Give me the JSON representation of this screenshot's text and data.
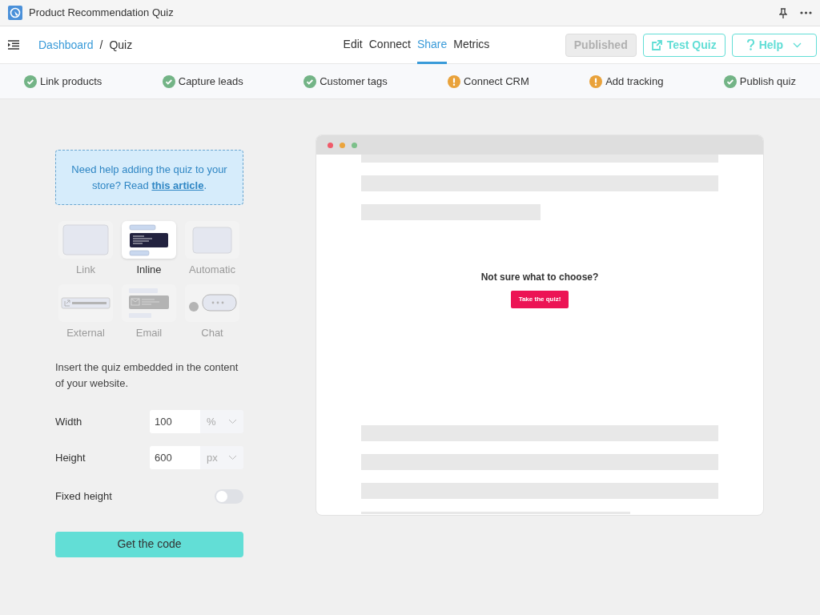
{
  "window": {
    "title": "Product Recommendation Quiz"
  },
  "breadcrumbs": [
    {
      "label": "Dashboard",
      "kind": "link"
    },
    {
      "label": "/",
      "kind": "separator"
    },
    {
      "label": "Quiz",
      "kind": "current"
    }
  ],
  "tabs": [
    {
      "label": "Edit",
      "selected": false
    },
    {
      "label": "Connect",
      "selected": false
    },
    {
      "label": "Share",
      "selected": true
    },
    {
      "label": "Metrics",
      "selected": false
    }
  ],
  "actions": [
    {
      "label": "Published",
      "kind": "status",
      "disabled": true
    },
    {
      "label": "Test Quiz",
      "kind": "external",
      "disabled": false
    },
    {
      "label": "Help",
      "kind": "help",
      "disabled": false
    }
  ],
  "steps": [
    {
      "label": "Link products",
      "done": true
    },
    {
      "label": "Capture leads",
      "done": true
    },
    {
      "label": "Customer tags",
      "done": true
    },
    {
      "label": "Connect CRM",
      "done": false
    },
    {
      "label": "Add tracking",
      "done": false
    },
    {
      "label": "Publish quiz",
      "done": true
    }
  ],
  "help_box": {
    "text_before": "Need help adding the quiz to your store? Read ",
    "link": "this article",
    "text_after": "."
  },
  "embed_types": [
    {
      "label": "Link",
      "kind": "link",
      "selected": false
    },
    {
      "label": "Inline",
      "kind": "inline",
      "selected": true
    },
    {
      "label": "Automatic",
      "kind": "automatic",
      "selected": false
    },
    {
      "label": "External",
      "kind": "external",
      "selected": false
    },
    {
      "label": "Email",
      "kind": "email",
      "selected": false
    },
    {
      "label": "Chat",
      "kind": "chat",
      "selected": false
    }
  ],
  "description": "Insert the quiz embedded in the content of your website.",
  "fields": [
    {
      "label": "Width",
      "value": "100",
      "unit": "%"
    },
    {
      "label": "Height",
      "value": "600",
      "unit": "px"
    }
  ],
  "toggle": {
    "label": "Fixed height",
    "on": false
  },
  "submit": "Get the code",
  "preview": {
    "heading": "Not sure what to choose?",
    "button": "Take the quiz!"
  }
}
